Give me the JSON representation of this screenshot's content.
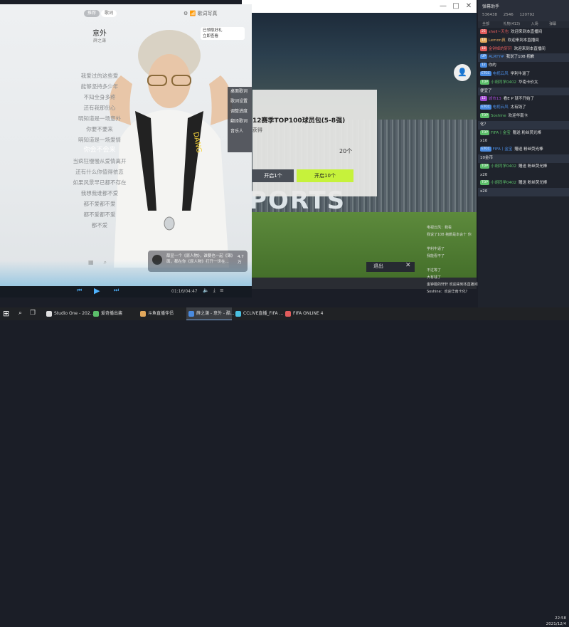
{
  "music_player": {
    "tab_a": "推荐",
    "tab_b": "歌词",
    "top_right": "⚙ 📶 歌词写真",
    "vip_line1": "已领取好礼",
    "vip_line2": "立即查看",
    "title": "意外",
    "artist": "薛之谦",
    "lyrics": [
      "我爱过的这些爱",
      "能够坚持多少年",
      "不知全身多疼",
      "还有我那份心",
      "明知道是一场意外",
      "你要不要来",
      "明知道是一场爱情",
      "你会不会来",
      "当疯狂慢慢从爱情离开",
      "还有什么你值得依恋",
      "如果风景早已都不存在",
      "我想我谁都不爱",
      "都不爱都不爱",
      "都不爱都不爱",
      "都不爱"
    ],
    "active_lyric_index": 7,
    "side_menu": [
      "桌面歌词",
      "歌词设置",
      "调整进度",
      "翻译歌词",
      "音乐人"
    ],
    "comment": "薛显一个《原人物》，谁要也一起《薄》面，都在你《原人物》打开一世在...",
    "comment_likes": "4.7万",
    "time": "01:16/04:47",
    "icons": {
      "prev": "⏮",
      "play": "▶",
      "next": "⏭"
    }
  },
  "game": {
    "title_controls": [
      "—",
      "□",
      "✕"
    ],
    "pack_title": "12赛季TOP100球员包(5-8强)",
    "pack_sub": "获得",
    "pack_count": "20个",
    "open_one": "开启1个",
    "open_ten": "开启10个",
    "exit_label": "退出",
    "exit_close": "✕",
    "banner_text": "PORTS"
  },
  "chat": {
    "title": "弹幕助手",
    "stats": [
      "536438",
      "2546",
      "120792"
    ],
    "tabs": [
      "全部",
      "礼物(413)",
      "入场",
      "弹幕"
    ],
    "messages": [
      {
        "lvl": "25",
        "color": "#e25c5c",
        "user": "shell~天也",
        "text": "欢迎来到本直播间"
      },
      {
        "lvl": "13",
        "color": "#e2a85c",
        "user": "Lemon真",
        "text": "欢迎来到本直播间"
      },
      {
        "lvl": "18",
        "color": "#e25c5c",
        "user": "金钟姬的轩轩",
        "text": "欢迎来到本直播间"
      },
      {
        "lvl": "UP",
        "color": "#4a8be0",
        "user": "ALRYY#",
        "text": "我说了108 抱歉"
      },
      {
        "lvl": "12",
        "color": "#4a8be0",
        "user": "",
        "text": "你的"
      },
      {
        "lvl": "ETCC",
        "color": "#4a8be0",
        "user": "电视云风",
        "text": "学利牛逼了"
      },
      {
        "lvl": "TOP",
        "color": "#5cbf6a",
        "user": "小胡同学0402",
        "text": "华南卡价太"
      },
      {
        "lvl": "",
        "color": "#1f232c",
        "user": "",
        "text": "便宜了"
      },
      {
        "lvl": "12",
        "color": "#a04ad0",
        "user": "城市13",
        "text": "看E P 就不开始了"
      },
      {
        "lvl": "ETCC",
        "color": "#4a8be0",
        "user": "电视云风",
        "text": "太有钱了"
      },
      {
        "lvl": "TOP",
        "color": "#5cbf6a",
        "user": "Soshine",
        "text": "欢迎华南卡"
      },
      {
        "lvl": "",
        "color": "#1f232c",
        "user": "",
        "text": "化？"
      },
      {
        "lvl": "TOP",
        "color": "#5cbf6a",
        "user": "FIFA丨金宝",
        "text": "赠送 粉丝荧光棒"
      },
      {
        "lvl": "",
        "color": "#1f232c",
        "user": "",
        "text": "x10"
      },
      {
        "lvl": "ETCC",
        "color": "#4a8be0",
        "user": "FIFA丨金宝",
        "text": "赠送 粉丝荧光棒"
      },
      {
        "lvl": "",
        "color": "#1f232c",
        "user": "",
        "text": "10金币"
      },
      {
        "lvl": "TOP",
        "color": "#5cbf6a",
        "user": "小胡同学0402",
        "text": "赠送 粉丝荧光棒"
      },
      {
        "lvl": "",
        "color": "#1f232c",
        "user": "",
        "text": "x20"
      },
      {
        "lvl": "TOP",
        "color": "#5cbf6a",
        "user": "小胡同学0402",
        "text": "赠送 粉丝荧光棒"
      },
      {
        "lvl": "",
        "color": "#1f232c",
        "user": "",
        "text": "x20"
      }
    ]
  },
  "video_ticker": [
    "电视云风：我看",
    "我说了108 抱歉是本会十 你",
    "",
    "学利牛逼了",
    "我能看不了",
    "",
    "不过等了",
    "大有钱了",
    "金钟姬的轩轩 欢迎来到本直播间",
    "Soshine：欢迎华南卡化？"
  ],
  "taskbar": {
    "start": "⊞",
    "items": [
      {
        "label": "Studio One - 202...",
        "color": "#e0e0e0",
        "active": false
      },
      {
        "label": "爱奇播出酱",
        "color": "#5cbf6a",
        "active": false
      },
      {
        "label": "斗鱼直播伴侣",
        "color": "#e2a85c",
        "active": false
      },
      {
        "label": "薛之谦 - 意外 - 酷...",
        "color": "#4a8be0",
        "active": true
      },
      {
        "label": "CCLIVE直播_FIFA ...",
        "color": "#4ac0e0",
        "active": false
      },
      {
        "label": "FIFA ONLINE 4",
        "color": "#e25c5c",
        "active": false
      }
    ],
    "time": "22:58",
    "date": "2021/12/4"
  }
}
